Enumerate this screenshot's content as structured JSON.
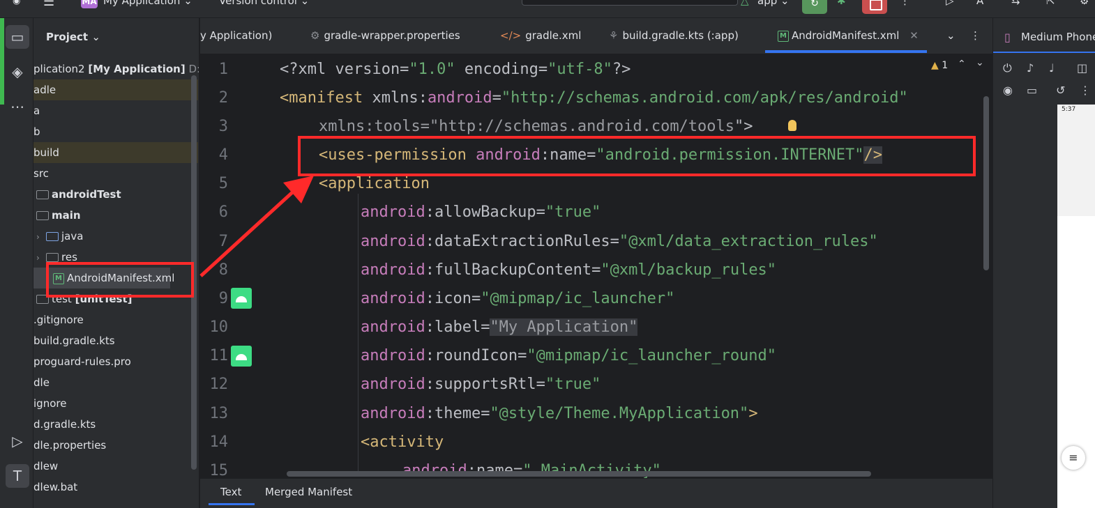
{
  "topbar": {
    "project_badge": "MA",
    "project_name": "My Application",
    "vcs": "Version control",
    "run_config": "app"
  },
  "project_panel": {
    "title": "Project",
    "rows": [
      {
        "text": "plication2",
        "bold": "[My Application]",
        "dim": "D:\\U"
      },
      {
        "text": "adle"
      },
      {
        "text": "a"
      },
      {
        "text": "b"
      },
      {
        "text": "build"
      },
      {
        "text": "src"
      },
      {
        "text": "androidTest"
      },
      {
        "text": "main"
      },
      {
        "text": "java"
      },
      {
        "text": "res"
      },
      {
        "text": "AndroidManifest.xml"
      },
      {
        "text": "test",
        "bold": "[unitTest]"
      },
      {
        "text": ".gitignore"
      },
      {
        "text": "build.gradle.kts"
      },
      {
        "text": "proguard-rules.pro"
      },
      {
        "text": "dle"
      },
      {
        "text": "ignore"
      },
      {
        "text": "d.gradle.kts"
      },
      {
        "text": "dle.properties"
      },
      {
        "text": "dlew"
      },
      {
        "text": "dlew.bat"
      }
    ]
  },
  "tabs": [
    {
      "label": "y Application)"
    },
    {
      "label": "gradle-wrapper.properties"
    },
    {
      "label": "gradle.xml"
    },
    {
      "label": "build.gradle.kts (:app)"
    },
    {
      "label": "AndroidManifest.xml"
    }
  ],
  "editor": {
    "warning_count": "1",
    "line_numbers": [
      "1",
      "2",
      "3",
      "4",
      "5",
      "6",
      "7",
      "8",
      "9",
      "10",
      "11",
      "12",
      "13",
      "14",
      "15"
    ]
  },
  "code": {
    "l1_a": "<?xml version=",
    "l1_b": "\"1.0\"",
    "l1_c": " encoding=",
    "l1_d": "\"utf-8\"",
    "l1_e": "?>",
    "l2_a": "<manifest",
    "l2_b": " xmlns:",
    "l2_c": "android",
    "l2_d": "=",
    "l2_e": "\"http://schemas.android.com/apk/res/android\"",
    "l3_a": "xmlns:tools=\"http://schemas.android.com/tools",
    "l3_b": "\">",
    "l4_a": "<uses-permission",
    "l4_b": " android",
    "l4_c": ":name=",
    "l4_d": "\"android.permission.INTERNET\"",
    "l4_e": "/>",
    "l5": "<application",
    "attrs": [
      {
        "ns": "android",
        "name": ":allowBackup=",
        "value": "\"true\""
      },
      {
        "ns": "android",
        "name": ":dataExtractionRules=",
        "value": "\"@xml/data_extraction_rules\""
      },
      {
        "ns": "android",
        "name": ":fullBackupContent=",
        "value": "\"@xml/backup_rules\""
      },
      {
        "ns": "android",
        "name": ":icon=",
        "value": "\"@mipmap/ic_launcher\""
      },
      {
        "ns": "android",
        "name": ":label=",
        "value": "\"My Application\""
      },
      {
        "ns": "android",
        "name": ":roundIcon=",
        "value": "\"@mipmap/ic_launcher_round\""
      },
      {
        "ns": "android",
        "name": ":supportsRtl=",
        "value": "\"true\""
      },
      {
        "ns": "android",
        "name": ":theme=",
        "value": "\"@style/Theme.MyApplication\""
      }
    ],
    "l13_end": ">",
    "l14": "<activity",
    "l15_ns": "android",
    "l15_name": ":name=",
    "l15_value": "\".MainActivity\""
  },
  "bottom_tabs": [
    "Text",
    "Merged Manifest"
  ],
  "device": {
    "title": "Medium Phone",
    "time": "5:37"
  },
  "colors": {
    "annotation_red": "#ff2a2a",
    "accent_blue": "#3574f0",
    "string_green": "#6aab73",
    "tag_yellow": "#d5b778",
    "namespace_purple": "#c77dbb"
  }
}
